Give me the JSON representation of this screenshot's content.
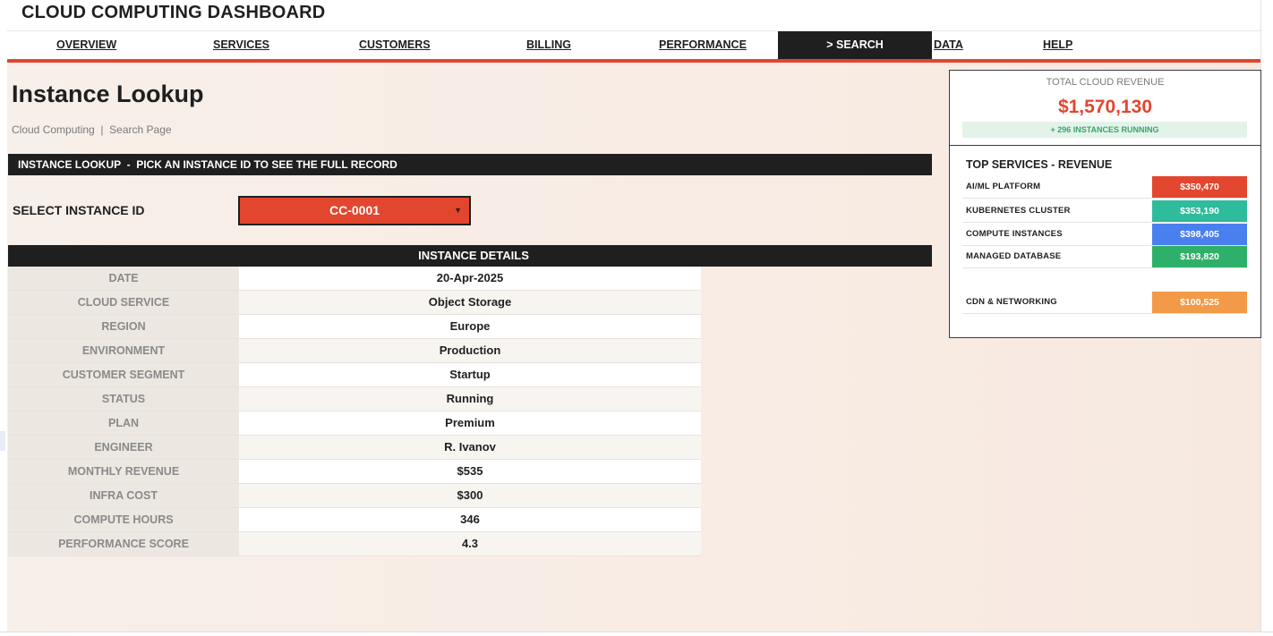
{
  "app": {
    "title": "CLOUD COMPUTING DASHBOARD"
  },
  "nav": {
    "items": [
      {
        "label": "OVERVIEW",
        "active": false
      },
      {
        "label": "SERVICES",
        "active": false
      },
      {
        "label": "CUSTOMERS",
        "active": false
      },
      {
        "label": "BILLING",
        "active": false
      },
      {
        "label": "PERFORMANCE",
        "active": false
      },
      {
        "label": "> SEARCH",
        "active": true
      },
      {
        "label": "DATA",
        "active": false
      },
      {
        "label": "HELP",
        "active": false
      }
    ]
  },
  "page": {
    "title": "Instance Lookup",
    "breadcrumb": "Cloud Computing  |  Search Page"
  },
  "lookup": {
    "section_title": "INSTANCE LOOKUP  -  PICK AN INSTANCE ID TO SEE THE FULL RECORD",
    "select_label": "SELECT INSTANCE ID",
    "selected_id": "CC-0001",
    "caret_icon": "chevron-down-icon"
  },
  "details": {
    "title": "INSTANCE DETAILS",
    "rows": [
      {
        "label": "DATE",
        "value": "20-Apr-2025"
      },
      {
        "label": "CLOUD SERVICE",
        "value": "Object Storage"
      },
      {
        "label": "REGION",
        "value": "Europe"
      },
      {
        "label": "ENVIRONMENT",
        "value": "Production"
      },
      {
        "label": "CUSTOMER SEGMENT",
        "value": "Startup"
      },
      {
        "label": "STATUS",
        "value": "Running"
      },
      {
        "label": "PLAN",
        "value": "Premium"
      },
      {
        "label": "ENGINEER",
        "value": "R. Ivanov"
      },
      {
        "label": "MONTHLY REVENUE",
        "value": "$535"
      },
      {
        "label": "INFRA COST",
        "value": "$300"
      },
      {
        "label": "COMPUTE HOURS",
        "value": "346"
      },
      {
        "label": "PERFORMANCE SCORE",
        "value": "4.3"
      }
    ]
  },
  "revenue": {
    "label": "TOTAL CLOUD REVENUE",
    "value": "$1,570,130",
    "badge": "+ 296 INSTANCES RUNNING"
  },
  "top_services": {
    "title": "TOP SERVICES - REVENUE",
    "items": [
      {
        "name": "AI/ML PLATFORM",
        "value": "$350,470",
        "color": "#e2462e"
      },
      {
        "name": "KUBERNETES CLUSTER",
        "value": "$353,190",
        "color": "#2ebc9c"
      },
      {
        "name": "COMPUTE INSTANCES",
        "value": "$398,405",
        "color": "#4a7fef"
      },
      {
        "name": "MANAGED DATABASE",
        "value": "$193,820",
        "color": "#2fb06a"
      },
      {
        "name": "CDN & NETWORKING",
        "value": "$100,525",
        "color": "#f29a48"
      }
    ]
  },
  "colors": {
    "accent": "#e2462e",
    "dark": "#1f1f1f",
    "success": "#3aa46a"
  }
}
